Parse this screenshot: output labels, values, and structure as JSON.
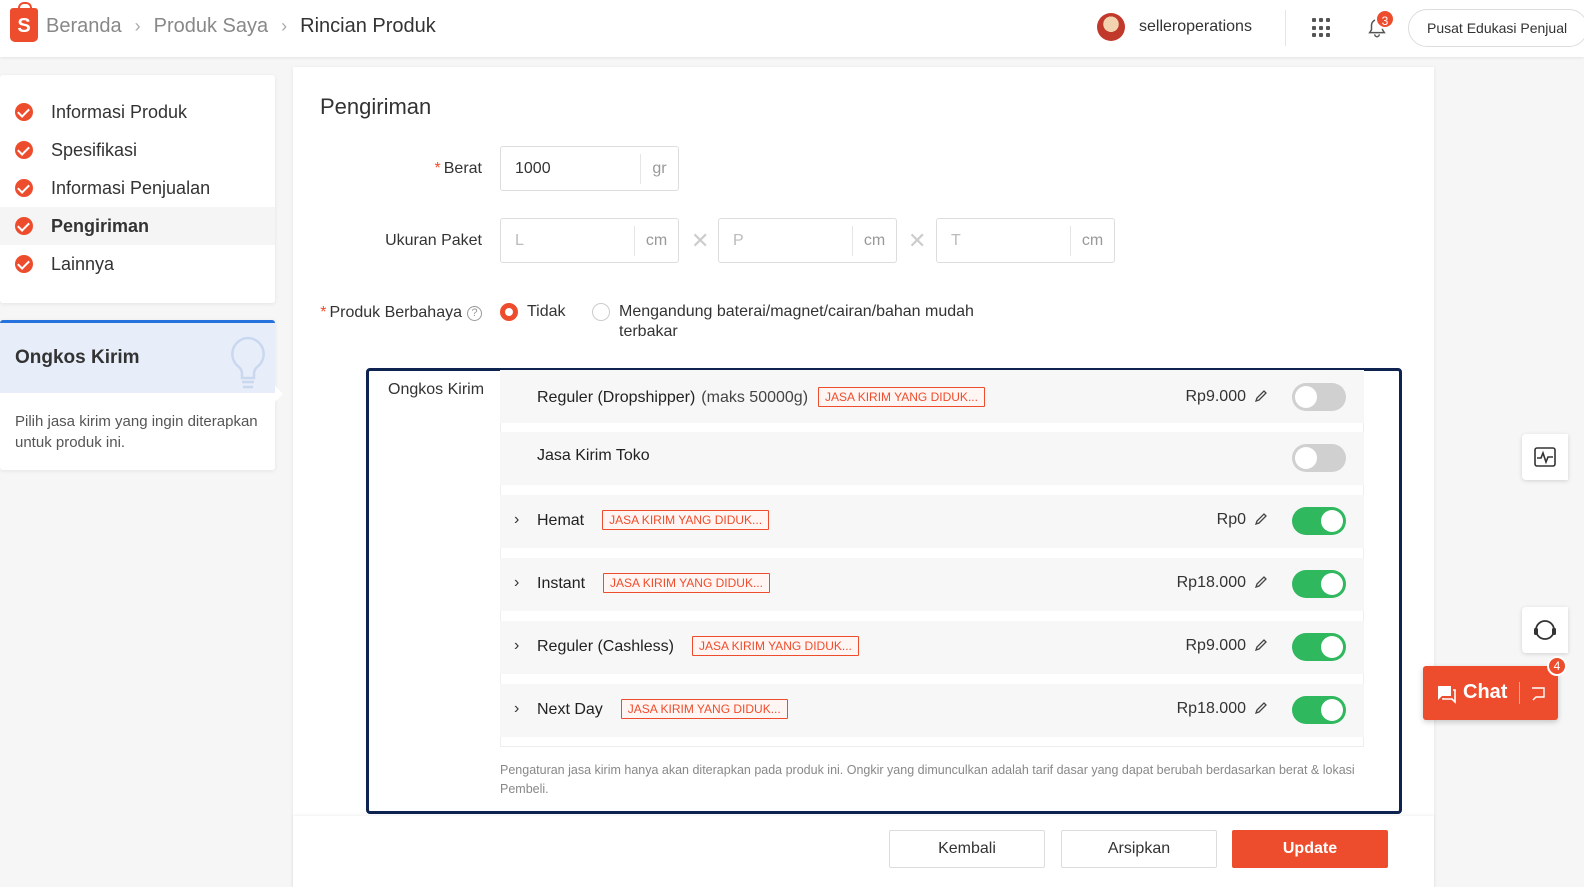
{
  "header": {
    "logo_letter": "S",
    "breadcrumbs": [
      "Beranda",
      "Produk Saya",
      "Rincian Produk"
    ],
    "username": "selleroperations",
    "notification_count": "3",
    "edu_button": "Pusat Edukasi Penjual",
    "accent": "#ee4d2d"
  },
  "sidebar": {
    "items": [
      {
        "label": "Informasi Produk"
      },
      {
        "label": "Spesifikasi"
      },
      {
        "label": "Informasi Penjualan"
      },
      {
        "label": "Pengiriman",
        "active": true
      },
      {
        "label": "Lainnya"
      }
    ],
    "tip": {
      "title": "Ongkos Kirim",
      "text": "Pilih jasa kirim yang ingin diterapkan untuk produk ini."
    }
  },
  "form": {
    "section_title": "Pengiriman",
    "weight": {
      "label": "Berat",
      "value": "1000",
      "unit": "gr"
    },
    "package": {
      "label": "Ukuran Paket",
      "fields": [
        {
          "placeholder": "L",
          "unit": "cm"
        },
        {
          "placeholder": "P",
          "unit": "cm"
        },
        {
          "placeholder": "T",
          "unit": "cm"
        }
      ]
    },
    "dangerous": {
      "label": "Produk Berbahaya",
      "help": "?",
      "options": [
        {
          "label": "Tidak",
          "selected": true
        },
        {
          "label": "Mengandung baterai/magnet/cairan/bahan mudah terbakar",
          "selected": false
        }
      ]
    },
    "shipping": {
      "label": "Ongkos Kirim",
      "rows": [
        {
          "name": "Reguler (Dropshipper)",
          "maks": "(maks 50000g)",
          "tag": "JASA KIRIM YANG DIDUK...",
          "price": "Rp9.000",
          "enabled": false,
          "expandable": false
        },
        {
          "name": "Jasa Kirim Toko",
          "maks": "",
          "tag": "",
          "price": "",
          "enabled": false,
          "expandable": false
        },
        {
          "name": "Hemat",
          "maks": "",
          "tag": "JASA KIRIM YANG DIDUK...",
          "price": "Rp0",
          "enabled": true,
          "expandable": true
        },
        {
          "name": "Instant",
          "maks": "",
          "tag": "JASA KIRIM YANG DIDUK...",
          "price": "Rp18.000",
          "enabled": true,
          "expandable": true
        },
        {
          "name": "Reguler (Cashless)",
          "maks": "",
          "tag": "JASA KIRIM YANG DIDUK...",
          "price": "Rp9.000",
          "enabled": true,
          "expandable": true
        },
        {
          "name": "Next Day",
          "maks": "",
          "tag": "JASA KIRIM YANG DIDUK...",
          "price": "Rp18.000",
          "enabled": true,
          "expandable": true
        }
      ],
      "note": "Pengaturan jasa kirim hanya akan diterapkan pada produk ini. Ongkir yang dimunculkan adalah tarif dasar yang dapat berubah berdasarkan berat & lokasi Pembeli."
    }
  },
  "footer": {
    "back": "Kembali",
    "archive": "Arsipkan",
    "update": "Update"
  },
  "chat": {
    "label": "Chat",
    "badge": "4"
  }
}
